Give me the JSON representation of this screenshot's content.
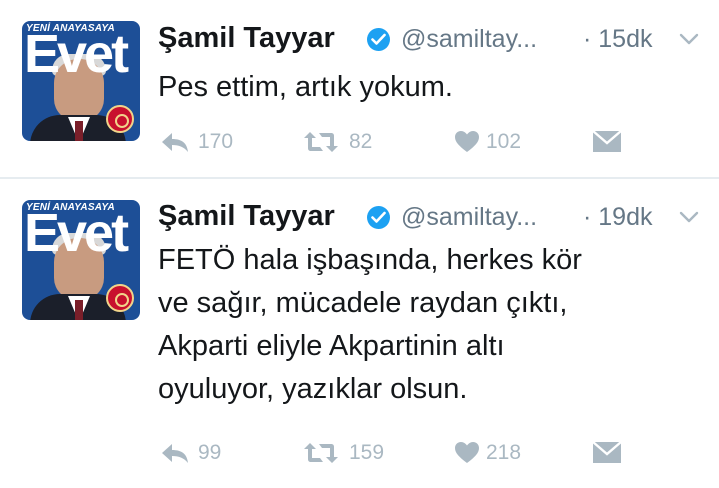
{
  "tweets": [
    {
      "avatar": {
        "banner": "YENİ ANAYASAYA",
        "word": "Evet"
      },
      "name": "Şamil Tayyar",
      "handle": "@samiltay...",
      "time": "· 15dk",
      "lines": [
        "Pes ettim, artık yokum."
      ],
      "replies": "170",
      "retweets": "82",
      "likes": "102"
    },
    {
      "avatar": {
        "banner": "YENİ ANAYASAYA",
        "word": "Evet"
      },
      "name": "Şamil Tayyar",
      "handle": "@samiltay...",
      "time": "· 19dk",
      "lines": [
        "FETÖ hala işbaşında, herkes kör",
        "ve sağır, mücadele raydan çıktı,",
        "Akparti eliyle Akpartinin altı",
        "oyuluyor, yazıklar olsun."
      ],
      "replies": "99",
      "retweets": "159",
      "likes": "218"
    }
  ],
  "icons": {
    "verified": "verified-badge-icon",
    "chevron": "chevron-down-icon",
    "reply": "reply-icon",
    "retweet": "retweet-icon",
    "like": "heart-icon",
    "dm": "envelope-icon"
  },
  "colors": {
    "verified": "#1da1f2",
    "muted": "#aab8c2",
    "handle": "#657786",
    "text": "#14171a"
  }
}
